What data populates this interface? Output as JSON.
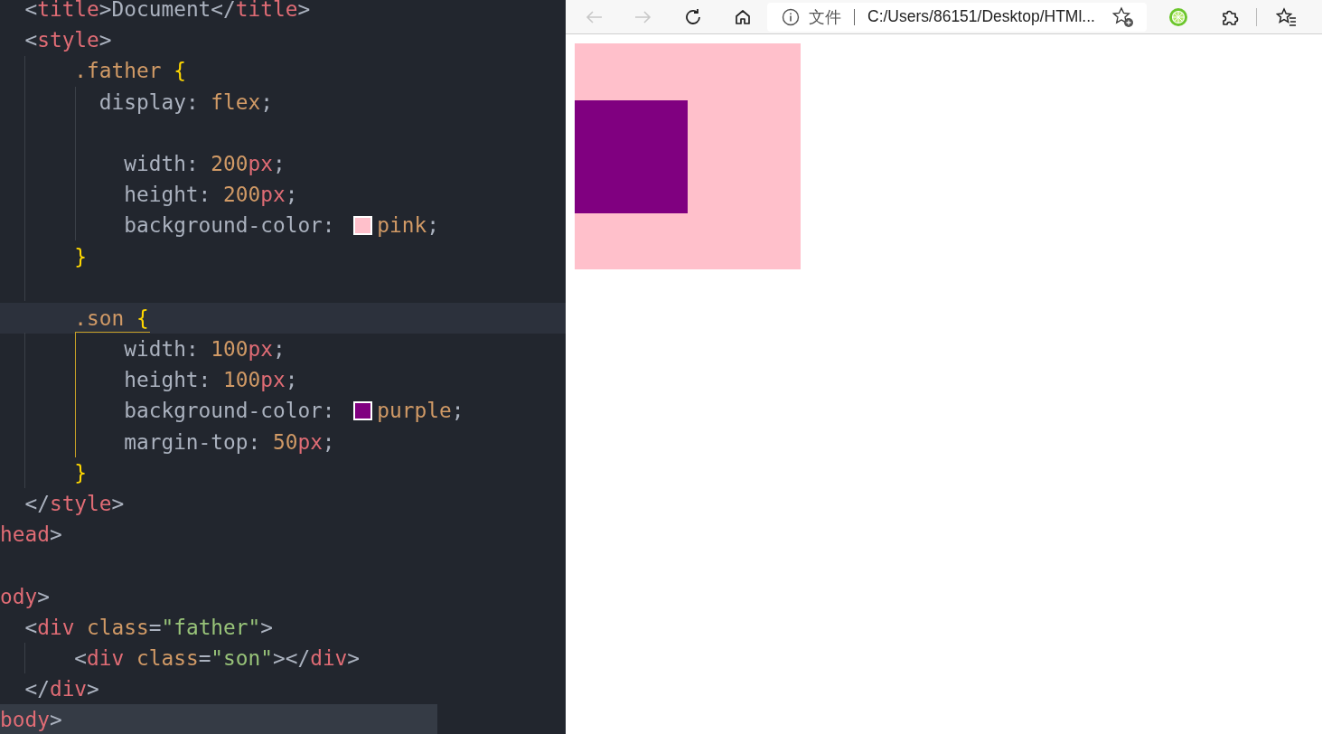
{
  "editor": {
    "lines": [
      {
        "kind": "code",
        "current": false,
        "selected": false,
        "tokens": [
          {
            "kind": "punct",
            "text": "  <"
          },
          {
            "kind": "tag",
            "text": "title"
          },
          {
            "kind": "punct",
            "text": ">"
          },
          {
            "kind": "text",
            "text": "Document"
          },
          {
            "kind": "punct",
            "text": "</"
          },
          {
            "kind": "tag",
            "text": "title"
          },
          {
            "kind": "punct",
            "text": ">"
          }
        ]
      },
      {
        "kind": "code",
        "current": false,
        "selected": false,
        "tokens": [
          {
            "kind": "punct",
            "text": "  <"
          },
          {
            "kind": "tag",
            "text": "style"
          },
          {
            "kind": "punct",
            "text": ">"
          }
        ]
      },
      {
        "kind": "code",
        "current": false,
        "selected": false,
        "tokens": [
          {
            "kind": "selector",
            "text": "      .father "
          },
          {
            "kind": "brace",
            "text": "{"
          }
        ]
      },
      {
        "kind": "code",
        "current": false,
        "selected": false,
        "tokens": [
          {
            "kind": "prop",
            "text": "        display"
          },
          {
            "kind": "punct",
            "text": ": "
          },
          {
            "kind": "value",
            "text": "flex"
          },
          {
            "kind": "punct",
            "text": ";"
          }
        ]
      },
      {
        "kind": "blank",
        "current": false,
        "selected": false
      },
      {
        "kind": "code",
        "current": false,
        "selected": false,
        "tokens": [
          {
            "kind": "prop",
            "text": "          width"
          },
          {
            "kind": "punct",
            "text": ": "
          },
          {
            "kind": "value",
            "text": "200"
          },
          {
            "kind": "unit",
            "text": "px"
          },
          {
            "kind": "punct",
            "text": ";"
          }
        ]
      },
      {
        "kind": "code",
        "current": false,
        "selected": false,
        "tokens": [
          {
            "kind": "prop",
            "text": "          height"
          },
          {
            "kind": "punct",
            "text": ": "
          },
          {
            "kind": "value",
            "text": "200"
          },
          {
            "kind": "unit",
            "text": "px"
          },
          {
            "kind": "punct",
            "text": ";"
          }
        ]
      },
      {
        "kind": "code",
        "current": false,
        "selected": false,
        "tokens": [
          {
            "kind": "prop",
            "text": "          background-color"
          },
          {
            "kind": "punct",
            "text": ": "
          },
          {
            "kind": "swatch",
            "color": "#ffc0cb"
          },
          {
            "kind": "value",
            "text": "pink"
          },
          {
            "kind": "punct",
            "text": ";"
          }
        ]
      },
      {
        "kind": "code",
        "current": false,
        "selected": false,
        "tokens": [
          {
            "kind": "brace",
            "text": "      }"
          }
        ]
      },
      {
        "kind": "blank",
        "current": false,
        "selected": false
      },
      {
        "kind": "code",
        "current": true,
        "selected": false,
        "tokens": [
          {
            "kind": "selector",
            "text": "      .son "
          },
          {
            "kind": "brace",
            "text": "{"
          }
        ]
      },
      {
        "kind": "code",
        "current": false,
        "selected": false,
        "tokens": [
          {
            "kind": "prop",
            "text": "          width"
          },
          {
            "kind": "punct",
            "text": ": "
          },
          {
            "kind": "value",
            "text": "100"
          },
          {
            "kind": "unit",
            "text": "px"
          },
          {
            "kind": "punct",
            "text": ";"
          }
        ]
      },
      {
        "kind": "code",
        "current": false,
        "selected": false,
        "tokens": [
          {
            "kind": "prop",
            "text": "          height"
          },
          {
            "kind": "punct",
            "text": ": "
          },
          {
            "kind": "value",
            "text": "100"
          },
          {
            "kind": "unit",
            "text": "px"
          },
          {
            "kind": "punct",
            "text": ";"
          }
        ]
      },
      {
        "kind": "code",
        "current": false,
        "selected": false,
        "tokens": [
          {
            "kind": "prop",
            "text": "          background-color"
          },
          {
            "kind": "punct",
            "text": ": "
          },
          {
            "kind": "swatch",
            "color": "#800080"
          },
          {
            "kind": "value",
            "text": "purple"
          },
          {
            "kind": "punct",
            "text": ";"
          }
        ]
      },
      {
        "kind": "code",
        "current": false,
        "selected": false,
        "tokens": [
          {
            "kind": "prop",
            "text": "          margin-top"
          },
          {
            "kind": "punct",
            "text": ": "
          },
          {
            "kind": "value",
            "text": "50"
          },
          {
            "kind": "unit",
            "text": "px"
          },
          {
            "kind": "punct",
            "text": ";"
          }
        ]
      },
      {
        "kind": "code",
        "current": false,
        "selected": false,
        "tokens": [
          {
            "kind": "brace",
            "text": "      }"
          }
        ]
      },
      {
        "kind": "code",
        "current": false,
        "selected": false,
        "tokens": [
          {
            "kind": "punct",
            "text": "  </"
          },
          {
            "kind": "tag",
            "text": "style"
          },
          {
            "kind": "punct",
            "text": ">"
          }
        ]
      },
      {
        "kind": "code",
        "current": false,
        "selected": false,
        "tokens": [
          {
            "kind": "tag",
            "text": "head"
          },
          {
            "kind": "punct",
            "text": ">"
          }
        ]
      },
      {
        "kind": "blank",
        "current": false,
        "selected": false
      },
      {
        "kind": "code",
        "current": false,
        "selected": false,
        "tokens": [
          {
            "kind": "tag",
            "text": "ody"
          },
          {
            "kind": "punct",
            "text": ">"
          }
        ]
      },
      {
        "kind": "code",
        "current": false,
        "selected": false,
        "tokens": [
          {
            "kind": "punct",
            "text": "  <"
          },
          {
            "kind": "tag",
            "text": "div "
          },
          {
            "kind": "attr",
            "text": "class"
          },
          {
            "kind": "punct",
            "text": "="
          },
          {
            "kind": "string",
            "text": "\"father\""
          },
          {
            "kind": "punct",
            "text": ">"
          }
        ]
      },
      {
        "kind": "code",
        "current": false,
        "selected": false,
        "tokens": [
          {
            "kind": "punct",
            "text": "      <"
          },
          {
            "kind": "tag",
            "text": "div "
          },
          {
            "kind": "attr",
            "text": "class"
          },
          {
            "kind": "punct",
            "text": "="
          },
          {
            "kind": "string",
            "text": "\"son\""
          },
          {
            "kind": "punct",
            "text": "></"
          },
          {
            "kind": "tag",
            "text": "div"
          },
          {
            "kind": "punct",
            "text": ">"
          }
        ]
      },
      {
        "kind": "code",
        "current": false,
        "selected": false,
        "tokens": [
          {
            "kind": "punct",
            "text": "  </"
          },
          {
            "kind": "tag",
            "text": "div"
          },
          {
            "kind": "punct",
            "text": ">"
          }
        ]
      },
      {
        "kind": "code",
        "current": false,
        "selected": true,
        "tokens": [
          {
            "kind": "tag",
            "text": "body"
          },
          {
            "kind": "punct",
            "text": ">"
          }
        ]
      }
    ]
  },
  "browser": {
    "nav_buttons": [
      {
        "kind": "back",
        "disabled": true
      },
      {
        "kind": "forward",
        "disabled": true
      },
      {
        "kind": "refresh",
        "disabled": false
      },
      {
        "kind": "home",
        "disabled": false
      }
    ],
    "address_bar": {
      "site_label": "文件",
      "url": "C:/Users/86151/Desktop/HTMl..."
    },
    "page": {
      "boxes": [
        {
          "color": "#ffc0cb",
          "children": [
            {
              "color": "#800080"
            }
          ]
        }
      ]
    }
  }
}
